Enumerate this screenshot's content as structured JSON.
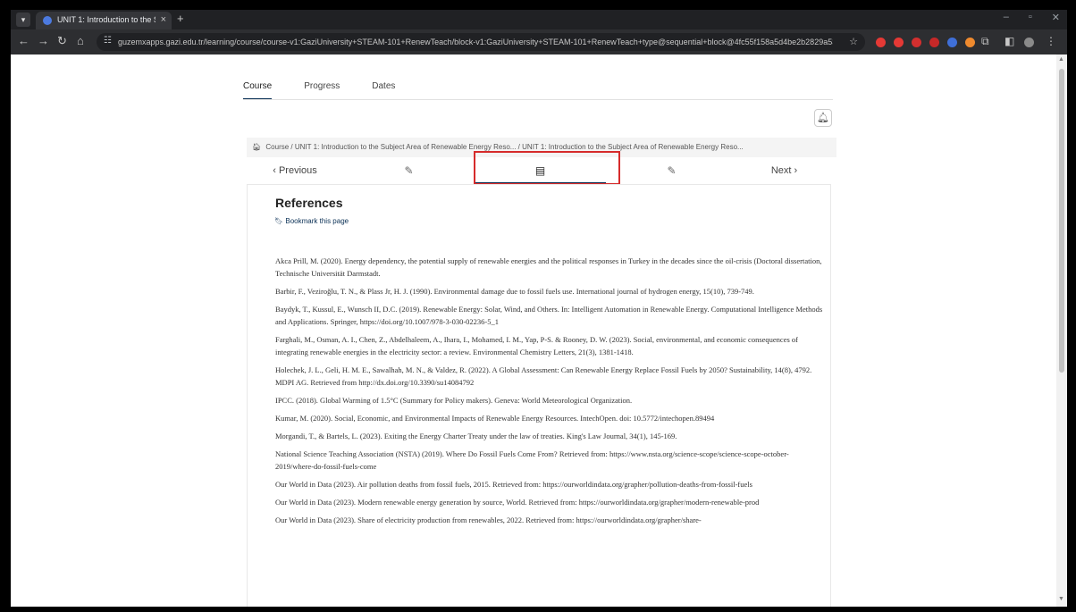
{
  "browser": {
    "tab_title": "UNIT 1: Introduction to the Sub",
    "tab_close": "×",
    "new_tab": "+",
    "url": "guzemxapps.gazi.edu.tr/learning/course/course-v1:GaziUniversity+STEAM-101+RenewTeach/block-v1:GaziUniversity+STEAM-101+RenewTeach+type@sequential+block@4fc55f158a5d4be2b2829a53a63dc1f5..."
  },
  "course_nav": {
    "tabs": [
      "Course",
      "Progress",
      "Dates"
    ]
  },
  "breadcrumb": {
    "home": "Course",
    "sep": "/",
    "item1": "UNIT 1: Introduction to the Subject Area of Renewable Energy Reso...",
    "item2": "UNIT 1: Introduction to the Subject Area of Renewable Energy Reso..."
  },
  "sequence": {
    "prev": "‹  Previous",
    "next": "Next  ›"
  },
  "unit": {
    "title": "References",
    "bookmark": "Bookmark this page"
  },
  "references": [
    "Akca Prill, M. (2020). Energy dependency, the potential supply of renewable energies and the political responses in Turkey in the decades since the oil-crisis (Doctoral dissertation, Technische Universität Darmstadt.",
    "Barbir, F., Veziroğlu, T. N., & Plass Jr, H. J. (1990). Environmental damage due to fossil fuels use. International journal of hydrogen energy, 15(10), 739-749.",
    "Baydyk, T., Kussul, E., Wunsch II, D.C. (2019). Renewable Energy: Solar, Wind, and Others. In: Intelligent Automation in Renewable Energy. Computational Intelligence Methods and Applications. Springer, https://doi.org/10.1007/978-3-030-02236-5_1",
    "Farghali, M., Osman, A. I., Chen, Z., Abdelhaleem, A., Ihara, I., Mohamed, I. M., Yap, P-S. & Rooney, D. W. (2023). Social, environmental, and economic consequences of integrating renewable energies in the electricity sector: a review. Environmental Chemistry Letters, 21(3), 1381-1418.",
    "Holechek, J. L., Geli, H. M. E., Sawalhah, M. N., & Valdez, R. (2022). A Global Assessment: Can Renewable Energy Replace Fossil Fuels by 2050? Sustainability, 14(8), 4792. MDPI AG. Retrieved from http://dx.doi.org/10.3390/su14084792",
    "IPCC. (2018). Global Warming of 1.5°C (Summary for Policy makers). Geneva: World Meteorological Organization.",
    "Kumar, M. (2020). Social, Economic, and Environmental Impacts of Renewable Energy Resources. IntechOpen. doi: 10.5772/intechopen.89494",
    "Morgandi, T., & Bartels, L. (2023). Exiting the Energy Charter Treaty under the law of treaties. King's Law Journal, 34(1), 145-169.",
    "National Science Teaching Association (NSTA) (2019). Where Do Fossil Fuels Come From? Retrieved from: https://www.nsta.org/science-scope/science-scope-october-2019/where-do-fossil-fuels-come",
    "Our World in Data (2023). Air pollution deaths from fossil fuels, 2015. Retrieved from: https://ourworldindata.org/grapher/pollution-deaths-from-fossil-fuels",
    "Our World in Data (2023). Modern renewable energy generation by source, World. Retrieved from: https://ourworldindata.org/grapher/modern-renewable-prod",
    "Our World in Data (2023). Share of electricity production from renewables, 2022. Retrieved from: https://ourworldindata.org/grapher/share-"
  ]
}
